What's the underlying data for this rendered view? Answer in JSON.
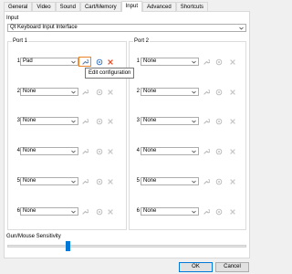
{
  "tabs": [
    "General",
    "Video",
    "Sound",
    "Cart/Memory",
    "Input",
    "Advanced",
    "Shortcuts"
  ],
  "active_tab": "Input",
  "input_label": "Input",
  "interface_value": "Qt Keyboard Input Interface",
  "port1": {
    "title": "Port 1",
    "rows": [
      {
        "num": "1",
        "value": "Pad"
      },
      {
        "num": "2",
        "value": "None"
      },
      {
        "num": "3",
        "value": "None"
      },
      {
        "num": "4",
        "value": "None"
      },
      {
        "num": "5",
        "value": "None"
      },
      {
        "num": "6",
        "value": "None"
      }
    ]
  },
  "port2": {
    "title": "Port 2",
    "rows": [
      {
        "num": "1",
        "value": "None"
      },
      {
        "num": "2",
        "value": "None"
      },
      {
        "num": "3",
        "value": "None"
      },
      {
        "num": "4",
        "value": "None"
      },
      {
        "num": "5",
        "value": "None"
      },
      {
        "num": "6",
        "value": "None"
      }
    ]
  },
  "tooltip": "Edit configuration",
  "sensitivity_label": "Gun/Mouse Sensitivity",
  "sensitivity_level": 0.25,
  "ok_label": "OK",
  "cancel_label": "Cancel",
  "colors": {
    "accent": "#0078d7",
    "focus": "#e8842c",
    "delete": "#e0522c"
  }
}
